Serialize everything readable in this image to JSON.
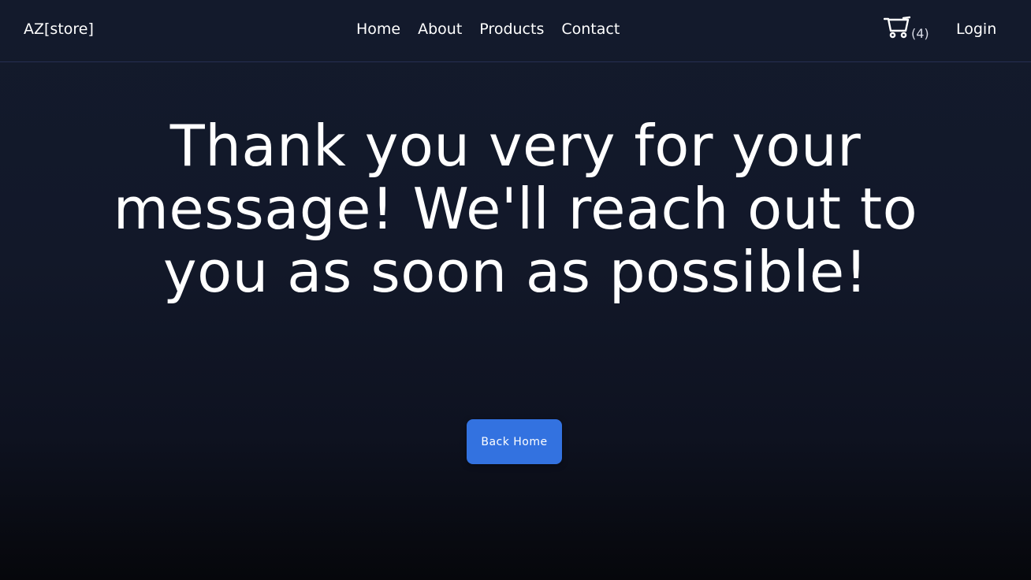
{
  "header": {
    "brand": "AZ[store]",
    "nav": [
      "Home",
      "About",
      "Products",
      "Contact"
    ],
    "cart": {
      "icon": "cart-icon",
      "count_label": "(4)"
    },
    "login_label": "Login"
  },
  "main": {
    "message": "Thank you very for your message! We'll reach out to you as soon as possible!",
    "back_button_label": "Back Home"
  },
  "colors": {
    "background": "#131a2c",
    "accent": "#3372e0",
    "text": "#ffffff"
  }
}
